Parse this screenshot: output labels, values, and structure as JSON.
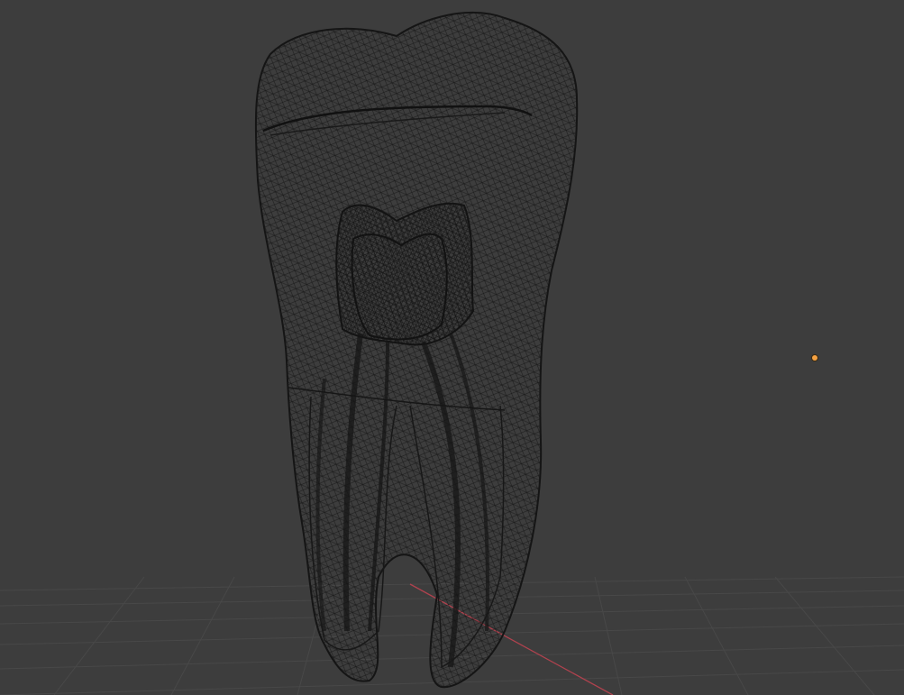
{
  "viewport": {
    "background_color": "#3d3d3d",
    "grid_color": "#484848",
    "x_axis_color": "#b0424e",
    "wire_color": "#141414",
    "selected_origin_color": "#f5a142"
  },
  "scene": {
    "object": "tooth-mesh",
    "display_mode": "wireframe",
    "floor_grid_visible": true,
    "light_origin_visible": true
  }
}
